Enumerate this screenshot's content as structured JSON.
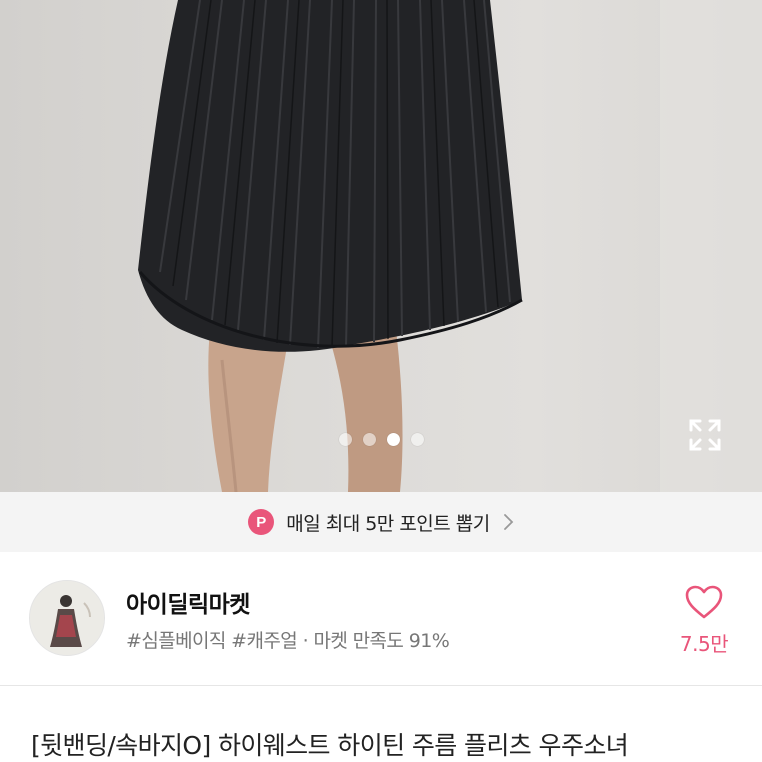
{
  "carousel": {
    "image_description": "black pleated mini skirt",
    "dot_count": 4,
    "active_index": 2,
    "expand_icon": "expand-icon"
  },
  "promo": {
    "badge": "P",
    "text": "매일 최대 5만 포인트 뽑기",
    "badge_color": "#e9557a"
  },
  "shop": {
    "name": "아이딜릭마켓",
    "tags": "#심플베이직 #캐주얼",
    "satisfaction": "· 마켓 만족도 91%",
    "like_count": "7.5만",
    "accent": "#e9557a"
  },
  "product": {
    "title": "[뒷밴딩/속바지O] 하이웨스트 하이틴 주름 플리츠 우주소녀"
  }
}
